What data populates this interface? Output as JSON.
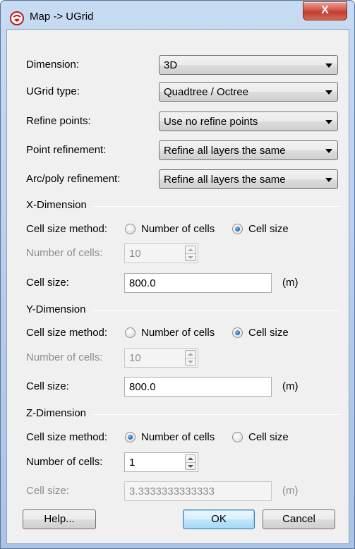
{
  "window": {
    "title": "Map -> UGrid",
    "close_label": "X"
  },
  "settings": {
    "dimension": {
      "label": "Dimension:",
      "value": "3D"
    },
    "ugrid_type": {
      "label": "UGrid type:",
      "value": "Quadtree / Octree"
    },
    "refine_points": {
      "label": "Refine points:",
      "value": "Use no refine points"
    },
    "point_refinement": {
      "label": "Point refinement:",
      "value": "Refine all layers the same"
    },
    "arc_poly_refinement": {
      "label": "Arc/poly refinement:",
      "value": "Refine all layers the same"
    }
  },
  "x_dimension": {
    "title": "X-Dimension",
    "method_label": "Cell size method:",
    "opt_cells": "Number of cells",
    "opt_size": "Cell size",
    "selected": "size",
    "num_cells_label": "Number of cells:",
    "num_cells": "10",
    "cell_size_label": "Cell size:",
    "cell_size": "800.0",
    "unit": "(m)"
  },
  "y_dimension": {
    "title": "Y-Dimension",
    "method_label": "Cell size method:",
    "opt_cells": "Number of cells",
    "opt_size": "Cell size",
    "selected": "size",
    "num_cells_label": "Number of cells:",
    "num_cells": "10",
    "cell_size_label": "Cell size:",
    "cell_size": "800.0",
    "unit": "(m)"
  },
  "z_dimension": {
    "title": "Z-Dimension",
    "method_label": "Cell size method:",
    "opt_cells": "Number of cells",
    "opt_size": "Cell size",
    "selected": "cells",
    "num_cells_label": "Number of cells:",
    "num_cells": "1",
    "cell_size_label": "Cell size:",
    "cell_size": "3.3333333333333",
    "unit": "(m)"
  },
  "buttons": {
    "help": "Help...",
    "ok": "OK",
    "cancel": "Cancel"
  },
  "colors": {
    "title_bar": "#b9cfea",
    "client_bg": "#f0f0f0",
    "close_button": "#c8453a",
    "radio_selected": "#1b63b4",
    "disabled_text": "#8d8d8d"
  }
}
